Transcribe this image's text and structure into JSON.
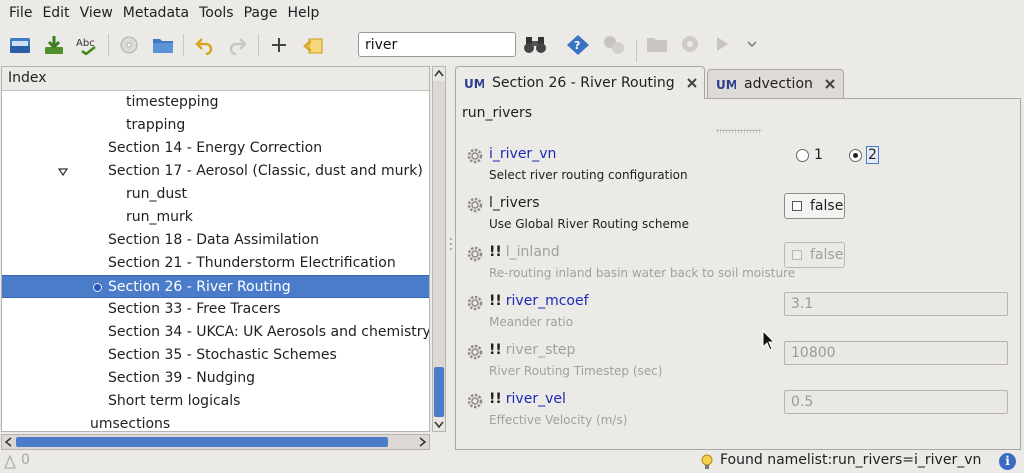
{
  "menu": [
    "File",
    "Edit",
    "View",
    "Metadata",
    "Tools",
    "Page",
    "Help"
  ],
  "search": {
    "value": "river"
  },
  "tree": {
    "header": "Index",
    "items": [
      {
        "label": "timestepping",
        "level": 3
      },
      {
        "label": "trapping",
        "level": 3
      },
      {
        "label": "Section 14 - Energy Correction",
        "level": 2
      },
      {
        "label": "Section 17 - Aerosol (Classic, dust and murk)",
        "level": 2,
        "expanded": true
      },
      {
        "label": "run_dust",
        "level": 3
      },
      {
        "label": "run_murk",
        "level": 3
      },
      {
        "label": "Section 18 - Data Assimilation",
        "level": 2
      },
      {
        "label": "Section 21 - Thunderstorm Electrification",
        "level": 2
      },
      {
        "label": "Section 26 - River Routing",
        "level": 2,
        "selected": true
      },
      {
        "label": "Section 33 - Free Tracers",
        "level": 2
      },
      {
        "label": "Section 34 - UKCA: UK Aerosols and chemistry",
        "level": 2
      },
      {
        "label": "Section 35 - Stochastic Schemes",
        "level": 2
      },
      {
        "label": "Section 39 - Nudging",
        "level": 2
      },
      {
        "label": "Short term logicals",
        "level": 2
      },
      {
        "label": "umsections",
        "level": 1
      }
    ]
  },
  "tabs": [
    {
      "icon": "UM",
      "label": "Section 26 - River Routing",
      "active": true
    },
    {
      "icon": "UM",
      "label": "advection",
      "active": false
    }
  ],
  "page": {
    "title": "run_rivers",
    "rows": [
      {
        "name": "i_river_vn",
        "desc": "Select river routing configuration",
        "kind": "radio",
        "options": [
          "1",
          "2"
        ],
        "selected": "2",
        "enabled": true,
        "link": true,
        "bang": ""
      },
      {
        "name": "l_rivers",
        "desc": "Use Global River Routing scheme",
        "kind": "check",
        "value": "false",
        "enabled": true,
        "link": false,
        "bang": ""
      },
      {
        "name": "l_inland",
        "desc": "Re-routing inland basin water back to soil moisture",
        "kind": "check",
        "value": "false",
        "enabled": false,
        "link": false,
        "bang": "!!"
      },
      {
        "name": "river_mcoef",
        "desc": "Meander ratio",
        "kind": "text",
        "value": "3.1",
        "enabled": false,
        "link": true,
        "bang": "!!"
      },
      {
        "name": "river_step",
        "desc": "River Routing Timestep (sec)",
        "kind": "text",
        "value": "10800",
        "enabled": false,
        "link": false,
        "bang": "!!"
      },
      {
        "name": "river_vel",
        "desc": "Effective Velocity (m/s)",
        "kind": "text",
        "value": "0.5",
        "enabled": false,
        "link": true,
        "bang": "!!"
      }
    ]
  },
  "status": {
    "count": "0",
    "message": "Found namelist:run_rivers=i_river_vn"
  },
  "colors": {
    "selection": "#4a7cc9",
    "link": "#1b2ab5",
    "disabled": "#a2a09b"
  }
}
